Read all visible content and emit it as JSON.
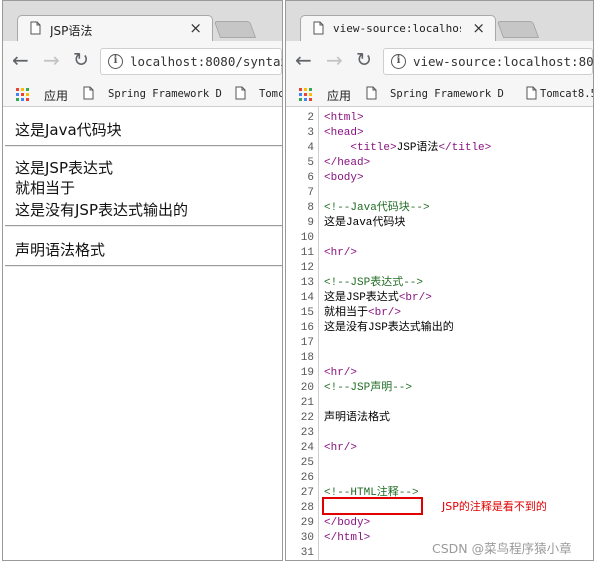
{
  "left_window": {
    "tab_title": "JSP语法",
    "url": "localhost:8080/syntax.",
    "bookmarks": [
      {
        "label": "应用"
      },
      {
        "label": "Spring Framework D"
      },
      {
        "label": "Tomc"
      }
    ],
    "page_lines": [
      "这是Java代码块",
      "这是JSP表达式",
      "就相当于",
      "这是没有JSP表达式输出的",
      "声明语法格式"
    ]
  },
  "right_window": {
    "tab_title": "view-source:localhost:",
    "url": "view-source:localhost:8080/",
    "bookmarks": [
      {
        "label": "应用"
      },
      {
        "label": "Spring Framework D"
      },
      {
        "label": "Tomcat8.5"
      }
    ],
    "source_lines": [
      {
        "n": "2",
        "tokens": [
          {
            "t": "<html>",
            "k": "tag"
          }
        ]
      },
      {
        "n": "3",
        "tokens": [
          {
            "t": "<head>",
            "k": "tag"
          }
        ]
      },
      {
        "n": "4",
        "tokens": [
          {
            "t": "    ",
            "k": "txt"
          },
          {
            "t": "<title>",
            "k": "tag"
          },
          {
            "t": "JSP语法",
            "k": "txt"
          },
          {
            "t": "</title>",
            "k": "tag"
          }
        ]
      },
      {
        "n": "5",
        "tokens": [
          {
            "t": "</head>",
            "k": "tag"
          }
        ]
      },
      {
        "n": "6",
        "tokens": [
          {
            "t": "<body>",
            "k": "tag"
          }
        ]
      },
      {
        "n": "7",
        "tokens": []
      },
      {
        "n": "8",
        "tokens": [
          {
            "t": "<!--Java代码块-->",
            "k": "cmt"
          }
        ]
      },
      {
        "n": "9",
        "tokens": [
          {
            "t": "这是Java代码块",
            "k": "txt"
          }
        ]
      },
      {
        "n": "10",
        "tokens": []
      },
      {
        "n": "11",
        "tokens": [
          {
            "t": "<hr/>",
            "k": "tag"
          }
        ]
      },
      {
        "n": "12",
        "tokens": []
      },
      {
        "n": "13",
        "tokens": [
          {
            "t": "<!--JSP表达式-->",
            "k": "cmt"
          }
        ]
      },
      {
        "n": "14",
        "tokens": [
          {
            "t": "这是JSP表达式",
            "k": "txt"
          },
          {
            "t": "<br/>",
            "k": "tag"
          }
        ]
      },
      {
        "n": "15",
        "tokens": [
          {
            "t": "就相当于",
            "k": "txt"
          },
          {
            "t": "<br/>",
            "k": "tag"
          }
        ]
      },
      {
        "n": "16",
        "tokens": [
          {
            "t": "这是没有JSP表达式输出的",
            "k": "txt"
          }
        ]
      },
      {
        "n": "17",
        "tokens": []
      },
      {
        "n": "18",
        "tokens": []
      },
      {
        "n": "19",
        "tokens": [
          {
            "t": "<hr/>",
            "k": "tag"
          }
        ]
      },
      {
        "n": "20",
        "tokens": [
          {
            "t": "<!--JSP声明-->",
            "k": "cmt"
          }
        ]
      },
      {
        "n": "21",
        "tokens": []
      },
      {
        "n": "22",
        "tokens": [
          {
            "t": "声明语法格式",
            "k": "txt"
          }
        ]
      },
      {
        "n": "23",
        "tokens": []
      },
      {
        "n": "24",
        "tokens": [
          {
            "t": "<hr/>",
            "k": "tag"
          }
        ]
      },
      {
        "n": "25",
        "tokens": []
      },
      {
        "n": "26",
        "tokens": []
      },
      {
        "n": "27",
        "tokens": [
          {
            "t": "<!--HTML注释-->",
            "k": "cmt"
          }
        ]
      },
      {
        "n": "28",
        "tokens": []
      },
      {
        "n": "29",
        "tokens": [
          {
            "t": "</body>",
            "k": "tag"
          }
        ]
      },
      {
        "n": "30",
        "tokens": [
          {
            "t": "</html>",
            "k": "tag"
          }
        ]
      },
      {
        "n": "31",
        "tokens": []
      }
    ]
  },
  "annotation": "JSP的注释是看不到的",
  "watermark": "CSDN @菜鸟程序猿小章",
  "colors": {
    "tag": "#881280",
    "comment": "#236e25",
    "highlight": "#e00000"
  }
}
